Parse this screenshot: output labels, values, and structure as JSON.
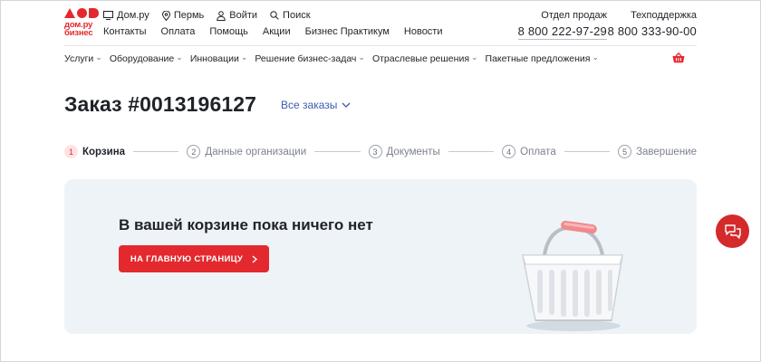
{
  "header": {
    "logo_text": "дом.ру\nбизнес",
    "top_links": [
      {
        "label": "Дом.ру",
        "icon": "monitor-icon"
      },
      {
        "label": "Пермь",
        "icon": "location-pin-icon"
      },
      {
        "label": "Войти",
        "icon": "user-icon"
      },
      {
        "label": "Поиск",
        "icon": "search-icon"
      }
    ],
    "nav_links": [
      "Контакты",
      "Оплата",
      "Помощь",
      "Акции",
      "Бизнес Практикум",
      "Новости"
    ],
    "sales": {
      "label": "Отдел продаж",
      "phone": "8 800 222-97-29"
    },
    "support": {
      "label": "Техподдержка",
      "phone": "8 800 333-90-00"
    }
  },
  "menu": [
    "Услуги",
    "Оборудование",
    "Инновации",
    "Решение бизнес-задач",
    "Отраслевые решения",
    "Пакетные предложения"
  ],
  "order": {
    "title": "Заказ #0013196127",
    "all_orders": "Все заказы"
  },
  "steps": [
    {
      "num": "1",
      "label": "Корзина",
      "active": true
    },
    {
      "num": "2",
      "label": "Данные организации",
      "active": false
    },
    {
      "num": "3",
      "label": "Документы",
      "active": false
    },
    {
      "num": "4",
      "label": "Оплата",
      "active": false
    },
    {
      "num": "5",
      "label": "Завершение",
      "active": false
    }
  ],
  "empty_cart": {
    "title": "В вашей корзине пока ничего нет",
    "button": "НА ГЛАВНУЮ СТРАНИЦУ"
  },
  "colors": {
    "accent": "#e3292d",
    "link": "#3a5cb0",
    "card_bg": "#eef3f7"
  }
}
